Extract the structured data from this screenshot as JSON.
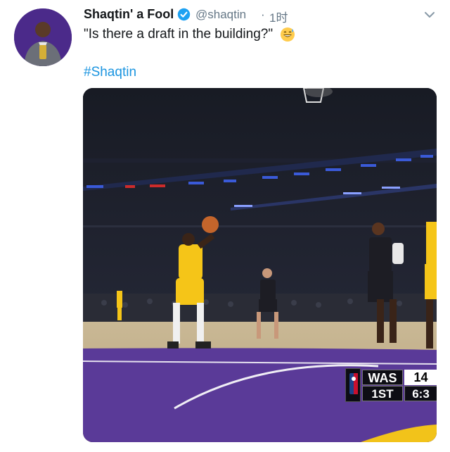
{
  "tweet": {
    "display_name": "Shaqtin' a Fool",
    "handle": "@shaqtin",
    "separator": "·",
    "time": "1时",
    "text": "\"Is there a draft in the building?\"",
    "hashtag": "#Shaqtin",
    "verified_icon": "verified-badge-icon",
    "menu_icon": "chevron-down-icon",
    "emoji": "grinning-sweat-emoji"
  },
  "scorebug": {
    "team": "WAS",
    "score": "14",
    "period": "1ST",
    "clock": "6:3"
  },
  "colors": {
    "link": "#1b95e0",
    "verified": "#1da1f2",
    "lakers_gold": "#f5c518",
    "court_purple": "#5a3a98"
  }
}
